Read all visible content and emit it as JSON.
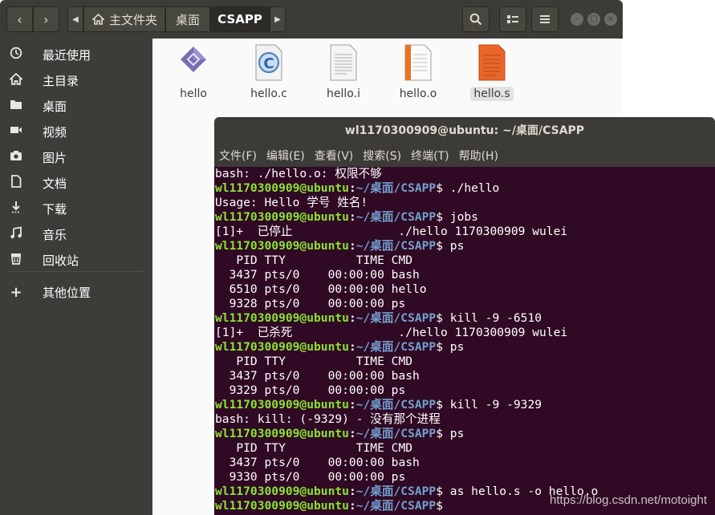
{
  "file_manager": {
    "breadcrumb": {
      "home": "主文件夹",
      "desktop": "桌面",
      "current": "CSAPP"
    },
    "sidebar": [
      {
        "label": "最近使用",
        "icon": "clock-icon"
      },
      {
        "label": "主目录",
        "icon": "home-icon"
      },
      {
        "label": "桌面",
        "icon": "folder-icon"
      },
      {
        "label": "视频",
        "icon": "video-icon"
      },
      {
        "label": "图片",
        "icon": "camera-icon"
      },
      {
        "label": "文档",
        "icon": "document-icon"
      },
      {
        "label": "下载",
        "icon": "download-icon"
      },
      {
        "label": "音乐",
        "icon": "music-icon"
      },
      {
        "label": "回收站",
        "icon": "trash-icon"
      },
      {
        "label": "其他位置",
        "icon": "plus-icon"
      }
    ],
    "files": [
      {
        "name": "hello",
        "icon": "executable-icon",
        "selected": false
      },
      {
        "name": "hello.c",
        "icon": "c-source-icon",
        "selected": false
      },
      {
        "name": "hello.i",
        "icon": "text-file-icon",
        "selected": false
      },
      {
        "name": "hello.o",
        "icon": "object-file-icon",
        "selected": false
      },
      {
        "name": "hello.s",
        "icon": "assembly-file-icon",
        "selected": true
      }
    ]
  },
  "terminal": {
    "title": "wl1170300909@ubuntu: ~/桌面/CSAPP",
    "menu": [
      "文件(F)",
      "编辑(E)",
      "查看(V)",
      "搜索(S)",
      "终端(T)",
      "帮助(H)"
    ],
    "prompt": {
      "user": "wl1170300909@ubuntu",
      "path": "~/桌面/CSAPP"
    },
    "lines": [
      {
        "out": "bash: ./hello.o: 权限不够"
      },
      {
        "cmd": "./hello"
      },
      {
        "out": "Usage: Hello 学号 姓名!"
      },
      {
        "cmd": "jobs"
      },
      {
        "out": "[1]+  已停止               ./hello 1170300909 wulei"
      },
      {
        "cmd": "ps"
      },
      {
        "out": "   PID TTY          TIME CMD"
      },
      {
        "out": "  3437 pts/0    00:00:00 bash"
      },
      {
        "out": "  6510 pts/0    00:00:00 hello"
      },
      {
        "out": "  9328 pts/0    00:00:00 ps"
      },
      {
        "cmd": "kill -9 -6510"
      },
      {
        "out": "[1]+  已杀死               ./hello 1170300909 wulei"
      },
      {
        "cmd": "ps"
      },
      {
        "out": "   PID TTY          TIME CMD"
      },
      {
        "out": "  3437 pts/0    00:00:00 bash"
      },
      {
        "out": "  9329 pts/0    00:00:00 ps"
      },
      {
        "cmd": "kill -9 -9329"
      },
      {
        "out": "bash: kill: (-9329) - 没有那个进程"
      },
      {
        "cmd": "ps"
      },
      {
        "out": "   PID TTY          TIME CMD"
      },
      {
        "out": "  3437 pts/0    00:00:00 bash"
      },
      {
        "out": "  9330 pts/0    00:00:00 ps"
      },
      {
        "cmd": "as hello.s -o hello.o"
      },
      {
        "cmd": ""
      }
    ]
  },
  "watermark": "https://blog.csdn.net/motoight",
  "colors": {
    "terminal_bg": "#300a24",
    "prompt_user": "#8ae234",
    "prompt_path": "#729fcf",
    "sidebar_bg": "#3d3c38",
    "header_bg": "#3c3b37"
  }
}
